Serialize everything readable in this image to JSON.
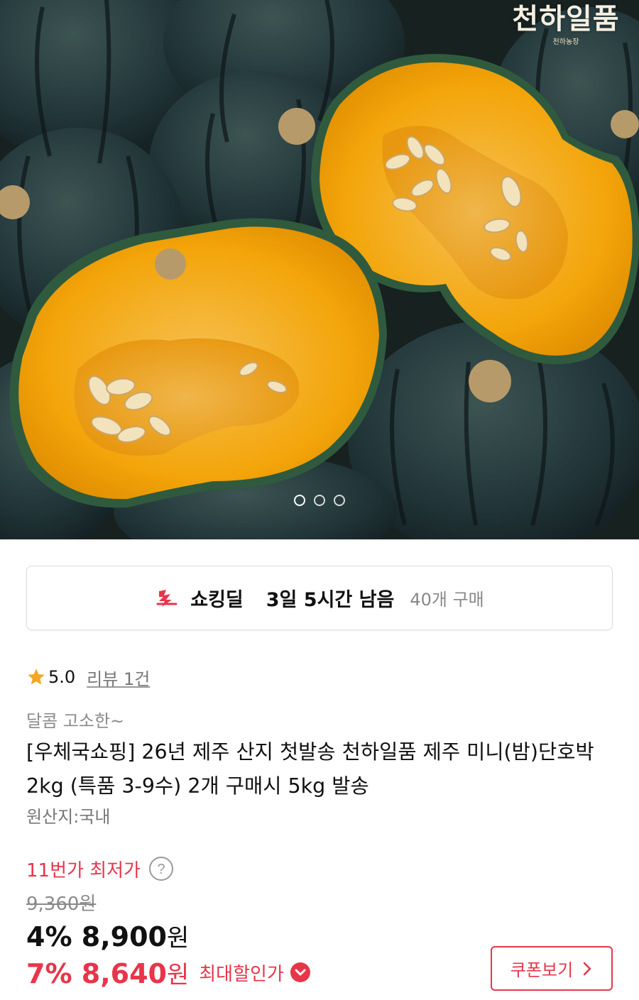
{
  "hero": {
    "watermark_main": "천하일품",
    "watermark_sub": "천하농장",
    "image_count": 3,
    "active_index": 0
  },
  "deal": {
    "icon": "shocking-deal-icon",
    "label": "쇼킹딜",
    "time_left": "3일 5시간 남음",
    "purchase_count": "40개 구매"
  },
  "rating": {
    "score": "5.0",
    "review_link": "리뷰 1건"
  },
  "product": {
    "subtitle": "달콤 고소한~",
    "title": "[우체국쇼핑] 26년 제주 산지 첫발송 천하일품 제주 미니(밤)단호박 2kg (특품 3-9수) 2개 구매시 5kg 발송",
    "origin": "원산지:국내"
  },
  "price": {
    "lowest_label": "11번가 최저가",
    "original": "9,360원",
    "discount1_rate": "4%",
    "discount1_price": "8,900",
    "discount2_rate": "7%",
    "discount2_price": "8,640",
    "currency": "원",
    "max_discount_label": "최대할인가",
    "coupon_button": "쿠폰보기"
  },
  "colors": {
    "accent_red": "#e8354a",
    "pumpkin_flesh": "#f3a50a",
    "pumpkin_skin": "#1f3331"
  }
}
